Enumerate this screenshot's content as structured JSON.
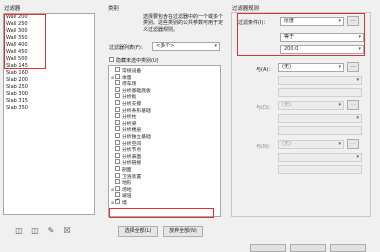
{
  "filters": {
    "title": "过滤器",
    "items": [
      "Wall 200",
      "Wall 250",
      "Wall 300",
      "Wall 350",
      "Wall 400",
      "Wall 450",
      "Wall 500",
      "Slab 145",
      "Slab 160",
      "Slab 200",
      "Slab 250",
      "Slab 300",
      "Slab 315",
      "Slab 350"
    ]
  },
  "categories": {
    "title": "类别",
    "description": "选择要包含在过滤器中的一个或多个类别。这些类别的公共参数可用于定义过滤器规则。",
    "filter_list_label": "过滤器列表(F)：",
    "filter_list_value": "<多个>",
    "hide_unchecked_label": "隐藏未选中类别(U)",
    "items": [
      {
        "label": "常规设备",
        "expandable": false
      },
      {
        "label": "体量",
        "expandable": true
      },
      {
        "label": "停车场",
        "expandable": false
      },
      {
        "label": "分析基础底板",
        "expandable": false
      },
      {
        "label": "分析板",
        "expandable": false
      },
      {
        "label": "分析支撑",
        "expandable": false
      },
      {
        "label": "分析条形基础",
        "expandable": false
      },
      {
        "label": "分析柱",
        "expandable": false
      },
      {
        "label": "分析梁",
        "expandable": false
      },
      {
        "label": "分析楼层",
        "expandable": false
      },
      {
        "label": "分析独立基础",
        "expandable": false
      },
      {
        "label": "分析空间",
        "expandable": false
      },
      {
        "label": "分析节点",
        "expandable": false
      },
      {
        "label": "分析表面",
        "expandable": false
      },
      {
        "label": "分析链接",
        "expandable": false
      },
      {
        "label": "剖面",
        "expandable": false
      },
      {
        "label": "卫浴装置",
        "expandable": false
      },
      {
        "label": "地形",
        "expandable": false
      },
      {
        "label": "场地",
        "expandable": true
      },
      {
        "label": "坡道",
        "expandable": false
      },
      {
        "label": "墙",
        "expandable": true
      }
    ],
    "select_all_label": "选择全部(L)",
    "deselect_all_label": "放弃全部(N)"
  },
  "rules": {
    "title": "过滤器规则",
    "filter_by_label": "过滤条件(I)：",
    "filter_by_value": "厚度",
    "operator_value": "等于",
    "value": "200.0",
    "and1_label": "与(A)：",
    "and1_value": "(无)",
    "and2_label": "与(D)：",
    "and2_value": "(无)",
    "and3_label": "与(N)：",
    "and3_value": "(无)",
    "more": "..."
  }
}
